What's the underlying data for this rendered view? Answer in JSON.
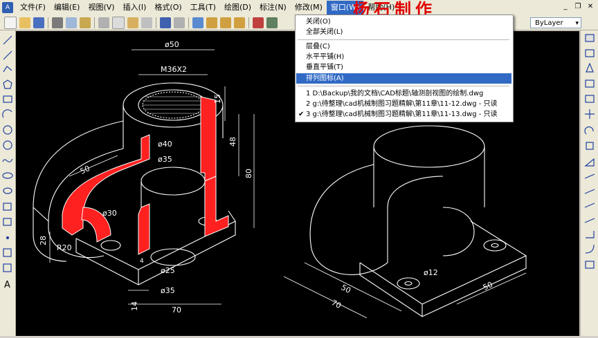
{
  "menubar": {
    "items": [
      {
        "label": "文件(F)"
      },
      {
        "label": "编辑(E)"
      },
      {
        "label": "视图(V)"
      },
      {
        "label": "插入(I)"
      },
      {
        "label": "格式(O)"
      },
      {
        "label": "工具(T)"
      },
      {
        "label": "绘图(D)"
      },
      {
        "label": "标注(N)"
      },
      {
        "label": "修改(M)"
      },
      {
        "label": "窗口(W)"
      },
      {
        "label": "帮助(H)"
      }
    ],
    "active_item": "窗口(W)",
    "watermark": "杨石制作"
  },
  "toolbar": {
    "layer_value": "ByLayer"
  },
  "window_menu": {
    "items": [
      {
        "label": "关闭(O)"
      },
      {
        "label": "全部关闭(L)"
      },
      {
        "label": "层叠(C)"
      },
      {
        "label": "水平平铺(H)"
      },
      {
        "label": "垂直平铺(T)"
      },
      {
        "label": "排列图标(A)"
      }
    ],
    "highlighted": "排列图标(A)",
    "files": [
      {
        "label": "1 D:\\Backup\\我的文档\\CAD标题\\轴测剖视图的绘制.dwg",
        "checked": false
      },
      {
        "label": "2 g:\\待整理\\cad机械制图习题精解\\第11章\\11-12.dwg - 只读",
        "checked": false
      },
      {
        "label": "3 g:\\待整理\\cad机械制图习题精解\\第11章\\11-13.dwg - 只读",
        "checked": true
      }
    ]
  },
  "drawing": {
    "dims": {
      "d50": "ø50",
      "m36": "M36X2",
      "d40": "ø40",
      "d35": "ø35",
      "d25": "ø25",
      "d35b": "ø35",
      "d30": "ø30",
      "r20": "R20",
      "d12": "ø12",
      "n15": "15",
      "n48": "48",
      "n80": "80",
      "n50a": "50",
      "n28": "28",
      "n14": "14",
      "n70a": "70",
      "n50b": "50",
      "n70b": "70",
      "n50c": "50",
      "n4": "4"
    },
    "colors": {
      "section_fill": "#ff2020",
      "line": "#ffffff",
      "background": "#000000"
    }
  }
}
